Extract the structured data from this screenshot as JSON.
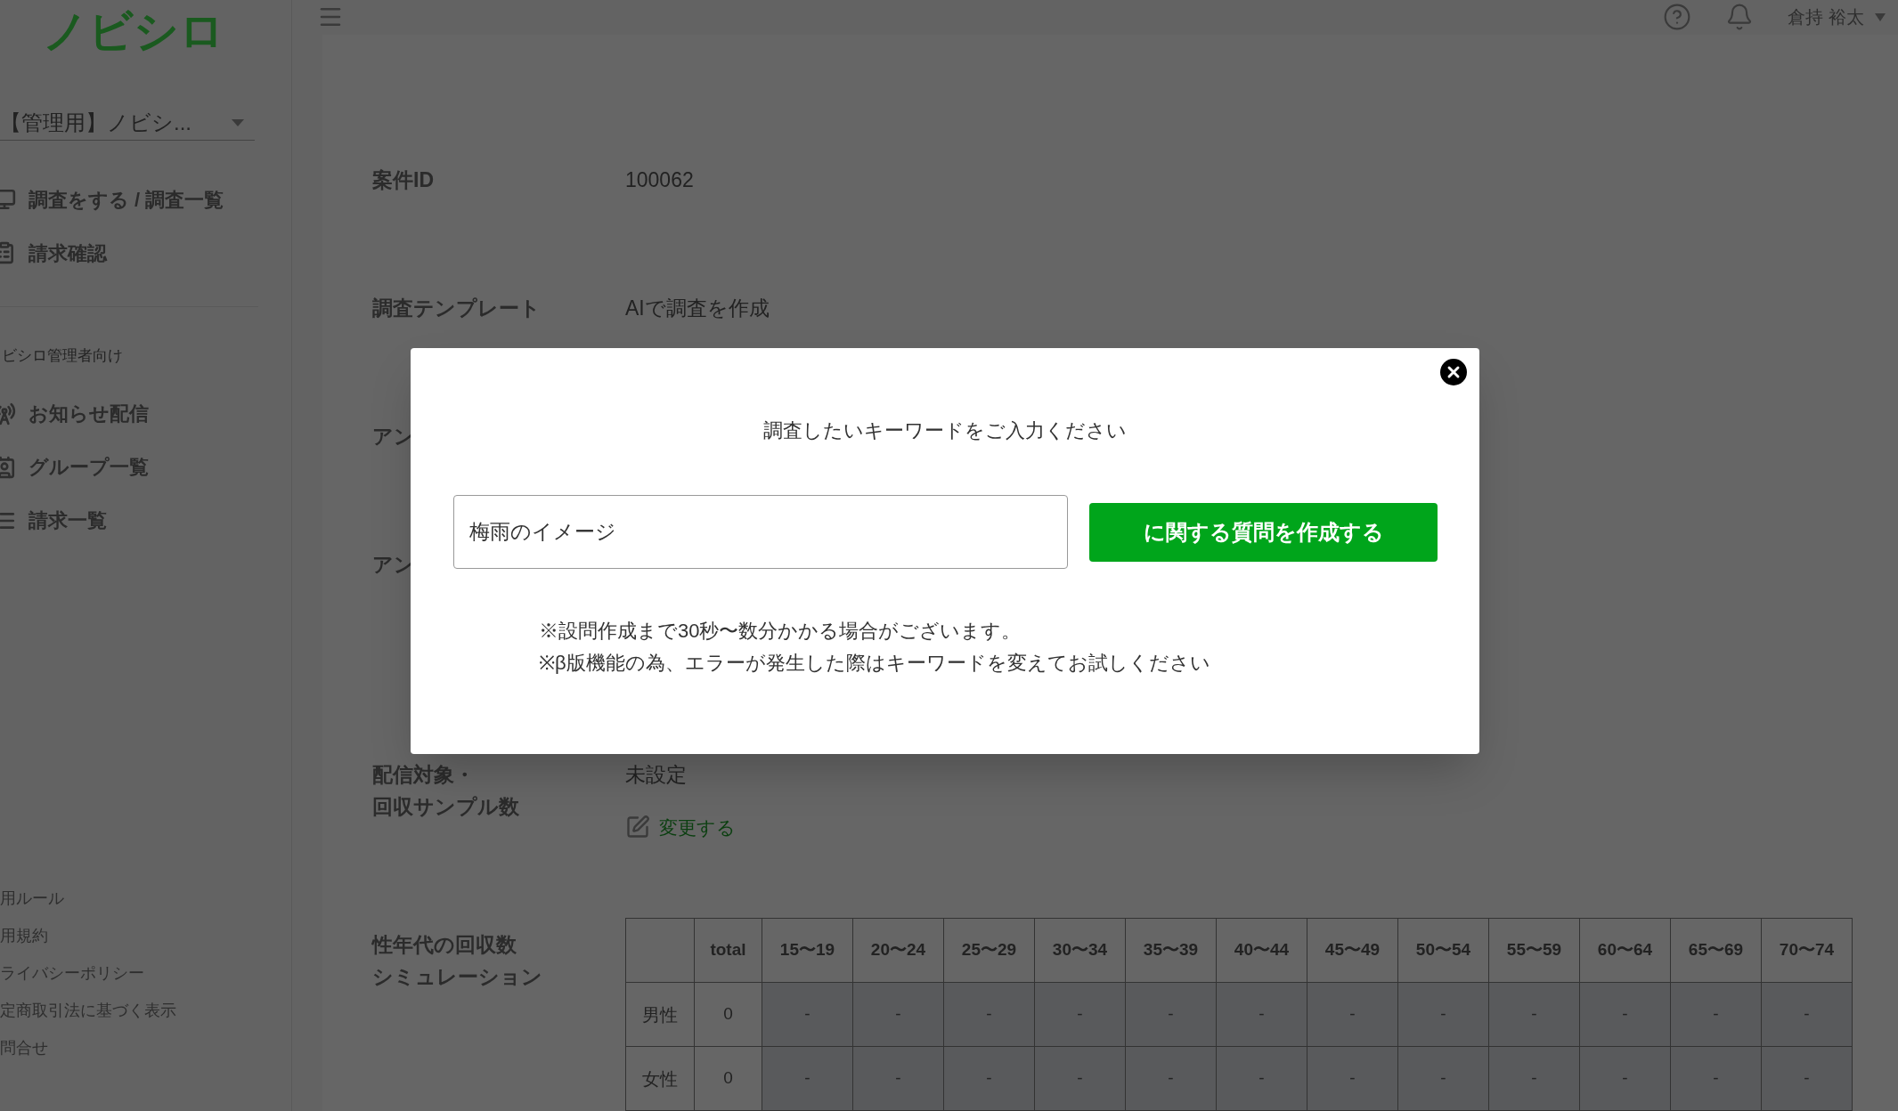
{
  "sidebar": {
    "logo": "ノビシロ",
    "account_select": {
      "value": "【管理用】ノビシ..."
    },
    "nav_items": [
      {
        "label": "調査をする / 調査一覧"
      },
      {
        "label": "請求確認"
      }
    ],
    "section_title": "ビシロ管理者向け",
    "admin_items": [
      {
        "label": "お知らせ配信"
      },
      {
        "label": "グループ一覧"
      },
      {
        "label": "請求一覧"
      }
    ],
    "footer_links": [
      "用ルール",
      "用規約",
      "ライバシーポリシー",
      "定商取引法に基づく表示",
      "問合せ"
    ]
  },
  "header": {
    "user_name": "倉持 裕太"
  },
  "details": [
    {
      "label_lines": [
        "案件ID"
      ],
      "value": "100062"
    },
    {
      "label_lines": [
        "調査テンプレート"
      ],
      "value": "AIで調査を作成"
    },
    {
      "label_lines": [
        "アン"
      ]
    },
    {
      "label_lines": [
        "アン"
      ]
    },
    {
      "label_lines": [
        "配信対象・",
        "回収サンプル数"
      ],
      "value": "未設定",
      "link": "変更する"
    }
  ],
  "simulation": {
    "label_lines": [
      "性年代の回収数",
      "シミュレーション"
    ],
    "columns": [
      "",
      "total",
      "15〜19",
      "20〜24",
      "25〜29",
      "30〜34",
      "35〜39",
      "40〜44",
      "45〜49",
      "50〜54",
      "55〜59",
      "60〜64",
      "65〜69",
      "70〜74"
    ],
    "rows": [
      {
        "cells": [
          "男性",
          "0",
          "-",
          "-",
          "-",
          "-",
          "-",
          "-",
          "-",
          "-",
          "-",
          "-",
          "-",
          "-"
        ]
      },
      {
        "cells": [
          "女性",
          "0",
          "-",
          "-",
          "-",
          "-",
          "-",
          "-",
          "-",
          "-",
          "-",
          "-",
          "-",
          "-"
        ]
      }
    ]
  },
  "modal": {
    "title": "調査したいキーワードをご入力ください",
    "input": {
      "value": "梅雨のイメージ"
    },
    "submit_button": "に関する質問を作成する",
    "notes": [
      "※設問作成まで30秒〜数分かかる場合がございます。",
      "※β版機能の為、エラーが発生した際はキーワードを変えてお試しください"
    ]
  }
}
